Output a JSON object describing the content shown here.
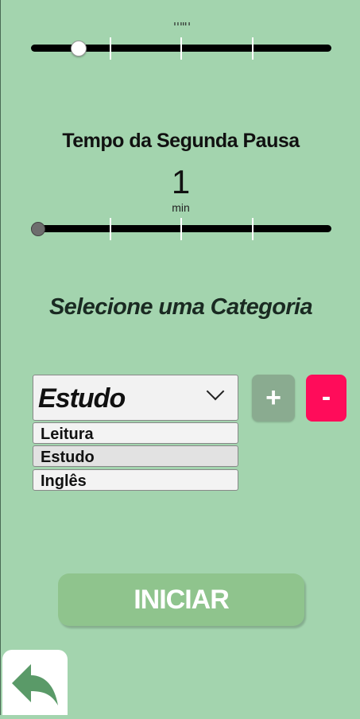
{
  "first_slider": {
    "unit_label": "min",
    "value_fraction": 0.16
  },
  "second_pause": {
    "title": "Tempo da Segunda Pausa",
    "value": "1",
    "unit": "min",
    "value_fraction": 0.0
  },
  "category": {
    "title": "Selecione uma Categoria",
    "selected": "Estudo",
    "options": [
      "Leitura",
      "Estudo",
      "Inglês"
    ],
    "add_label": "+",
    "remove_label": "-"
  },
  "start_button": {
    "label": "INICIAR"
  },
  "colors": {
    "background": "#a3d4ae",
    "add_button": "#8aab90",
    "remove_button": "#ff0c5a",
    "start_button": "#8fc48d",
    "back_arrow": "#5a9a68"
  },
  "icons": {
    "back": "back-arrow-icon",
    "dropdown": "chevron-down-icon"
  }
}
